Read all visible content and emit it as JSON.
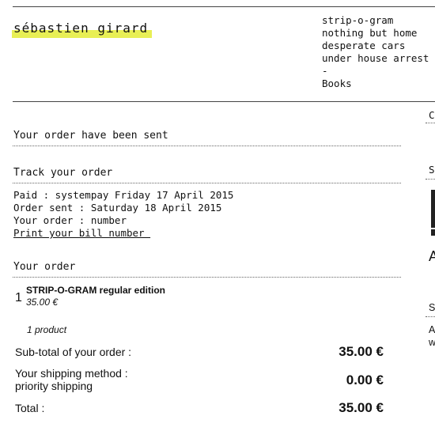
{
  "header": {
    "brand": "sébastien girard",
    "nav": [
      "strip-o-gram",
      "nothing but home",
      "desperate cars",
      "under house arrest",
      "-",
      "Books"
    ]
  },
  "confirmation": "Your order have been sent",
  "tracking": {
    "title": "Track your order",
    "paid": "Paid : systempay Friday 17 April 2015",
    "sent": "Order sent : Saturday 18 April 2015",
    "number": "Your order : number",
    "print_link": "Print your bill number "
  },
  "order": {
    "title": "Your order",
    "items": [
      {
        "qty": "1",
        "name": "STRIP-O-GRAM regular edition",
        "price": "35.00 €"
      }
    ],
    "product_count": "1 product",
    "subtotal_label": "Sub-total of your order :",
    "subtotal_value": "35.00 €",
    "shipping_label": "Your shipping method :",
    "shipping_method": "priority shipping",
    "shipping_value": "0.00 €",
    "total_label": "Total :",
    "total_value": "35.00 €"
  },
  "sidebar_fragments": {
    "c": "C",
    "s1": "S",
    "a1": "A",
    "s2": "S",
    "a2": "A",
    "w": "w"
  },
  "colors": {
    "highlight": "#e8ef55",
    "text": "#111111"
  }
}
